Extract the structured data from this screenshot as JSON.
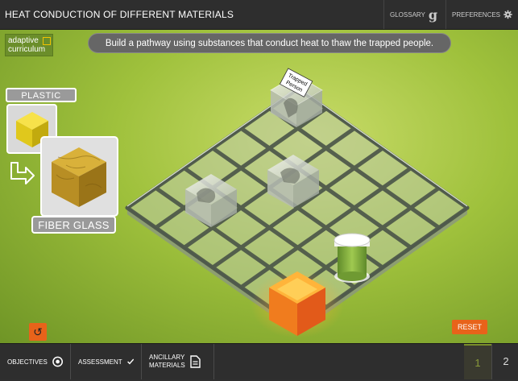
{
  "header": {
    "title": "HEAT CONDUCTION OF DIFFERENT MATERIALS",
    "glossary_label": "GLOSSARY",
    "preferences_label": "PREFERENCES"
  },
  "logo": {
    "line1": "adaptive",
    "line2": "curriculum"
  },
  "instruction": "Build a pathway using substances that conduct heat to thaw the trapped people.",
  "materials": {
    "current_label": "PLASTIC",
    "next_label": "FIBER GLASS"
  },
  "board": {
    "trapped_label_line1": "Trapped",
    "trapped_label_line2": "Person"
  },
  "controls": {
    "reset_label": "RESET",
    "undo_icon": "↺"
  },
  "footer": {
    "objectives_label": "OBJECTIVES",
    "assessment_label": "ASSESSMENT",
    "ancillary_line1": "ANCILLARY",
    "ancillary_line2": "MATERIALS",
    "pages": [
      "1",
      "2"
    ],
    "active_page": "1"
  },
  "colors": {
    "accent_orange": "#e8631a",
    "grass_green": "#9fc13c",
    "bar_dark": "#2e2e2e"
  }
}
